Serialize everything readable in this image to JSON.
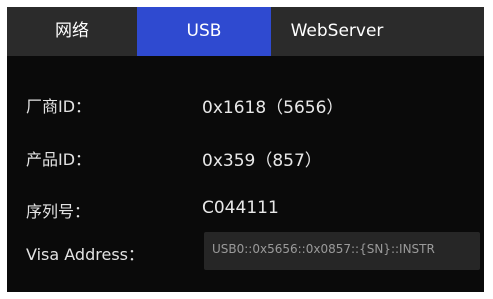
{
  "tabs": [
    {
      "label": "网络",
      "active": false
    },
    {
      "label": "USB",
      "active": true
    },
    {
      "label": "WebServer",
      "active": false
    }
  ],
  "fields": {
    "vendor_id": {
      "label": "厂商ID：",
      "value": "0x1618（5656）"
    },
    "product_id": {
      "label": "产品ID：",
      "value": "0x359（857）"
    },
    "serial_number": {
      "label": "序列号：",
      "value": "C044111"
    },
    "visa_address": {
      "label": "Visa Address：",
      "value": "USB0::0x5656::0x0857::{SN}::INSTR"
    }
  },
  "colors": {
    "panel_bg": "#0a0a0a",
    "tabbar_bg": "#2b2b2b",
    "active_tab": "#2f4ad0",
    "field_bg": "#262626"
  }
}
